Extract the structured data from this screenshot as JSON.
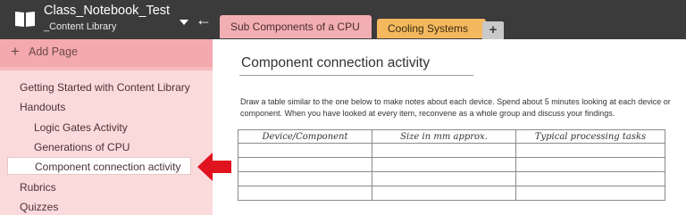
{
  "notebook": {
    "title": "Class_Notebook_Test",
    "section_group": "_Content Library"
  },
  "tabs": [
    {
      "label": "Sub Components of a CPU",
      "color": "#f3aeb4",
      "active": true
    },
    {
      "label": "Cooling Systems",
      "color": "#f4b95f",
      "active": false
    }
  ],
  "add_section_label": "+",
  "sidebar": {
    "add_page_label": "Add Page",
    "items": [
      {
        "label": "Getting Started with Content Library",
        "level": 1
      },
      {
        "label": "Handouts",
        "level": 1
      },
      {
        "label": "Logic Gates Activity",
        "level": 2
      },
      {
        "label": "Generations of CPU",
        "level": 2
      },
      {
        "label": "Component connection activity",
        "level": 2,
        "selected": true
      },
      {
        "label": "Rubrics",
        "level": 1
      },
      {
        "label": "Quizzes",
        "level": 1
      }
    ]
  },
  "page": {
    "title": "Component connection activity",
    "instructions": "Draw a table similar to the one below to make notes about each device. Spend about 5 minutes looking at each device or component. When you have looked at every item, reconvene as a whole group and discuss your findings.",
    "table": {
      "headers": [
        "Device/Component",
        "Size in mm approx.",
        "Typical processing tasks"
      ],
      "rows": [
        [
          "",
          "",
          ""
        ],
        [
          "",
          "",
          ""
        ],
        [
          "",
          "",
          ""
        ],
        [
          "",
          "",
          ""
        ]
      ]
    }
  },
  "colors": {
    "topbar": "#3b3b3b",
    "sidebar": "#f5b8bd",
    "arrow": "#e0141e"
  },
  "icons": {
    "notebook": "notebook-icon",
    "back": "back-icon",
    "dropdown": "chevron-down-icon",
    "add_page": "plus-icon",
    "annotation": "red-arrow-icon"
  }
}
